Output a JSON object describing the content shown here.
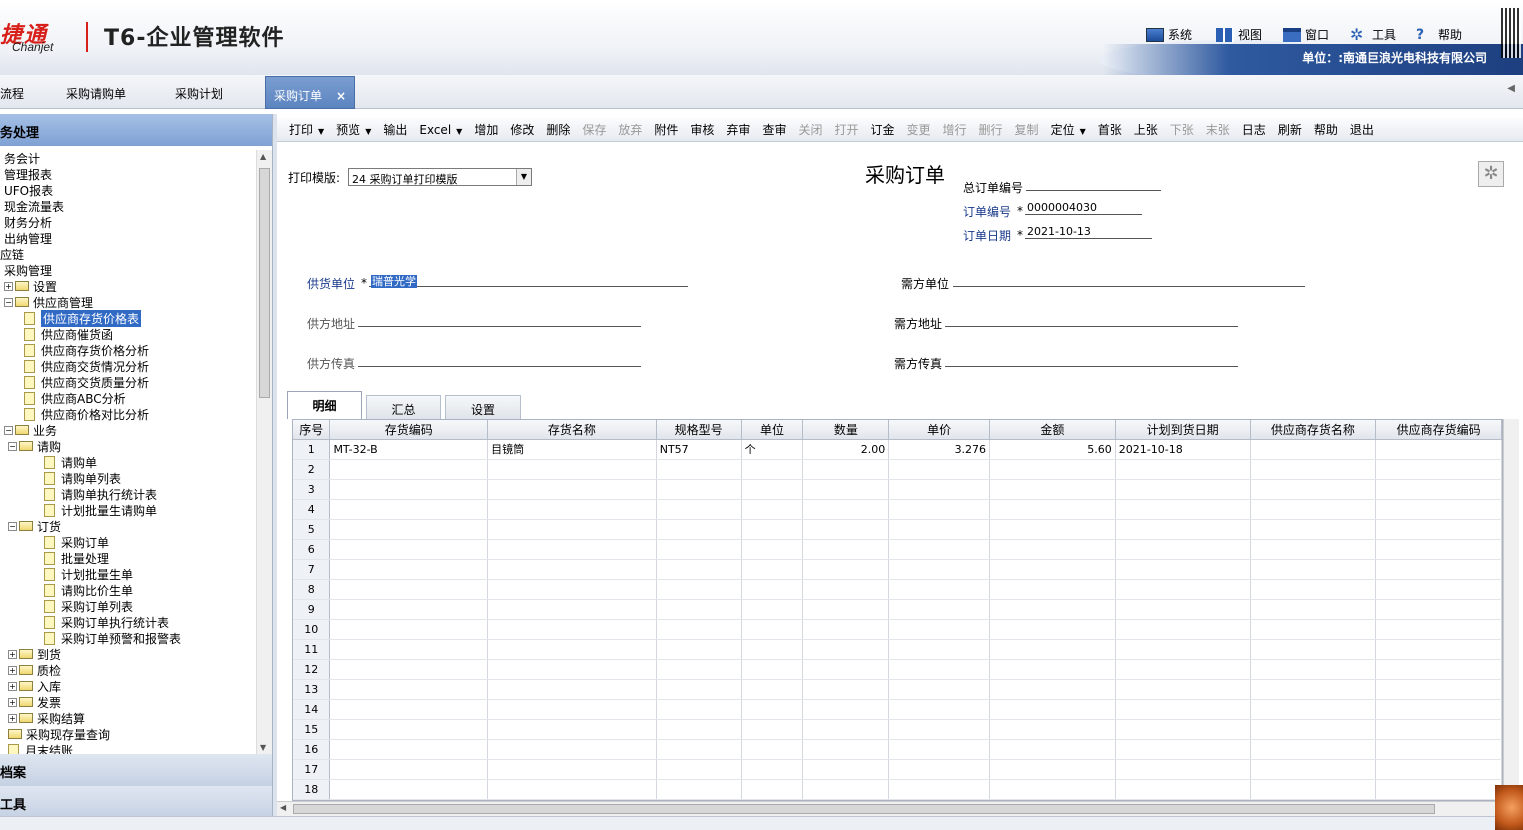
{
  "header": {
    "logo_cn": "畅捷通",
    "logo_visible_cn": "捷通",
    "logo_en": "Chanjet",
    "app_title": "T6-企业管理软件",
    "menu": [
      {
        "label": "系统",
        "icon": "monitor-icon"
      },
      {
        "label": "视图",
        "icon": "grid-view-icon"
      },
      {
        "label": "窗口",
        "icon": "window-icon"
      },
      {
        "label": "工具",
        "icon": "gear-icon"
      },
      {
        "label": "帮助",
        "icon": "help-icon"
      }
    ],
    "unit_text": "单位：:南通巨浪光电科技有限公司"
  },
  "tabs": [
    {
      "label": "流程"
    },
    {
      "label": "采购请购单"
    },
    {
      "label": "采购计划"
    },
    {
      "label": "采购订单",
      "active": true,
      "close": "×"
    }
  ],
  "left_panel": {
    "header": "务处理",
    "footer1": "档案",
    "footer2": "工具",
    "tree": [
      {
        "label": "务会计",
        "level": 0,
        "kind": "text"
      },
      {
        "label": "管理报表",
        "level": 0,
        "kind": "text"
      },
      {
        "label": "UFO报表",
        "level": 0,
        "kind": "text"
      },
      {
        "label": "现金流量表",
        "level": 0,
        "kind": "text"
      },
      {
        "label": "财务分析",
        "level": 0,
        "kind": "text"
      },
      {
        "label": "出纳管理",
        "level": 0,
        "kind": "text"
      },
      {
        "label": "应链",
        "level": -1,
        "kind": "text"
      },
      {
        "label": "采购管理",
        "level": 0,
        "kind": "text"
      },
      {
        "label": "设置",
        "level": 0,
        "kind": "folder",
        "pm": "+"
      },
      {
        "label": "供应商管理",
        "level": 0,
        "kind": "folder",
        "pm": "-"
      },
      {
        "label": "供应商存货价格表",
        "level": 2,
        "kind": "doc",
        "selected": true
      },
      {
        "label": "供应商催货函",
        "level": 2,
        "kind": "doc"
      },
      {
        "label": "供应商存货价格分析",
        "level": 2,
        "kind": "doc"
      },
      {
        "label": "供应商交货情况分析",
        "level": 2,
        "kind": "doc"
      },
      {
        "label": "供应商交货质量分析",
        "level": 2,
        "kind": "doc"
      },
      {
        "label": "供应商ABC分析",
        "level": 2,
        "kind": "doc"
      },
      {
        "label": "供应商价格对比分析",
        "level": 2,
        "kind": "doc"
      },
      {
        "label": "业务",
        "level": 0,
        "kind": "folder",
        "pm": "-"
      },
      {
        "label": "请购",
        "level": 1,
        "kind": "folder",
        "pm": "-"
      },
      {
        "label": "请购单",
        "level": 3,
        "kind": "doc"
      },
      {
        "label": "请购单列表",
        "level": 3,
        "kind": "doc"
      },
      {
        "label": "请购单执行统计表",
        "level": 3,
        "kind": "doc"
      },
      {
        "label": "计划批量生请购单",
        "level": 3,
        "kind": "doc"
      },
      {
        "label": "订货",
        "level": 1,
        "kind": "folder",
        "pm": "-"
      },
      {
        "label": "采购订单",
        "level": 3,
        "kind": "doc"
      },
      {
        "label": "批量处理",
        "level": 3,
        "kind": "doc"
      },
      {
        "label": "计划批量生单",
        "level": 3,
        "kind": "doc"
      },
      {
        "label": "请购比价生单",
        "level": 3,
        "kind": "doc"
      },
      {
        "label": "采购订单列表",
        "level": 3,
        "kind": "doc"
      },
      {
        "label": "采购订单执行统计表",
        "level": 3,
        "kind": "doc"
      },
      {
        "label": "采购订单预警和报警表",
        "level": 3,
        "kind": "doc"
      },
      {
        "label": "到货",
        "level": 1,
        "kind": "folder",
        "pm": "+"
      },
      {
        "label": "质检",
        "level": 1,
        "kind": "folder",
        "pm": "+"
      },
      {
        "label": "入库",
        "level": 1,
        "kind": "folder",
        "pm": "+"
      },
      {
        "label": "发票",
        "level": 1,
        "kind": "folder",
        "pm": "+"
      },
      {
        "label": "采购结算",
        "level": 1,
        "kind": "folder",
        "pm": "+"
      },
      {
        "label": "采购现存量查询",
        "level": 1,
        "kind": "folder"
      },
      {
        "label": "月末结账",
        "level": 1,
        "kind": "doc"
      }
    ]
  },
  "toolbar": [
    {
      "label": "打印",
      "dd": true
    },
    {
      "label": "预览",
      "dd": true
    },
    {
      "label": "输出"
    },
    {
      "label": "Excel",
      "dd": true
    },
    {
      "label": "增加"
    },
    {
      "label": "修改"
    },
    {
      "label": "删除"
    },
    {
      "label": "保存",
      "disabled": true
    },
    {
      "label": "放弃",
      "disabled": true
    },
    {
      "label": "附件"
    },
    {
      "label": "审核"
    },
    {
      "label": "弃审"
    },
    {
      "label": "查审"
    },
    {
      "label": "关闭",
      "disabled": true
    },
    {
      "label": "打开",
      "disabled": true
    },
    {
      "label": "订金"
    },
    {
      "label": "变更",
      "disabled": true
    },
    {
      "label": "增行",
      "disabled": true
    },
    {
      "label": "删行",
      "disabled": true
    },
    {
      "label": "复制",
      "disabled": true
    },
    {
      "label": "定位",
      "dd": true
    },
    {
      "label": "首张"
    },
    {
      "label": "上张"
    },
    {
      "label": "下张",
      "disabled": true
    },
    {
      "label": "末张",
      "disabled": true
    },
    {
      "label": "日志"
    },
    {
      "label": "刷新"
    },
    {
      "label": "帮助"
    },
    {
      "label": "退出"
    }
  ],
  "form": {
    "print_template_label": "打印模版:",
    "print_template_value": "24 采购订单打印模版",
    "title": "采购订单",
    "total_order_no_label": "总订单编号",
    "total_order_no": "",
    "order_no_label": "订单编号",
    "order_no": "0000004030",
    "order_date_label": "订单日期",
    "order_date": "2021-10-13",
    "required_mark": "*",
    "supplier_label": "供货单位",
    "supplier_value": "瑞普光学",
    "demand_unit_label": "需方单位",
    "supplier_addr_label": "供方地址",
    "demand_addr_label": "需方地址",
    "supplier_fax_label": "供方传真",
    "demand_fax_label": "需方传真"
  },
  "bottom_tabs": [
    {
      "label": "明细",
      "active": true
    },
    {
      "label": "汇总"
    },
    {
      "label": "设置"
    }
  ],
  "grid": {
    "columns": [
      "序号",
      "存货编码",
      "存货名称",
      "规格型号",
      "单位",
      "数量",
      "单价",
      "金额",
      "计划到货日期",
      "供应商存货名称",
      "供应商存货编码"
    ],
    "rows": [
      [
        "1",
        "MT-32-B",
        "目镜筒",
        "NT57",
        "个",
        "2.00",
        "3.276",
        "5.60",
        "2021-10-18",
        "",
        ""
      ],
      [
        "2"
      ],
      [
        "3"
      ],
      [
        "4"
      ],
      [
        "5"
      ],
      [
        "6"
      ],
      [
        "7"
      ],
      [
        "8"
      ],
      [
        "9"
      ],
      [
        "10"
      ],
      [
        "11"
      ],
      [
        "12"
      ],
      [
        "13"
      ],
      [
        "14"
      ],
      [
        "15"
      ],
      [
        "16"
      ],
      [
        "17"
      ],
      [
        "18"
      ]
    ]
  }
}
